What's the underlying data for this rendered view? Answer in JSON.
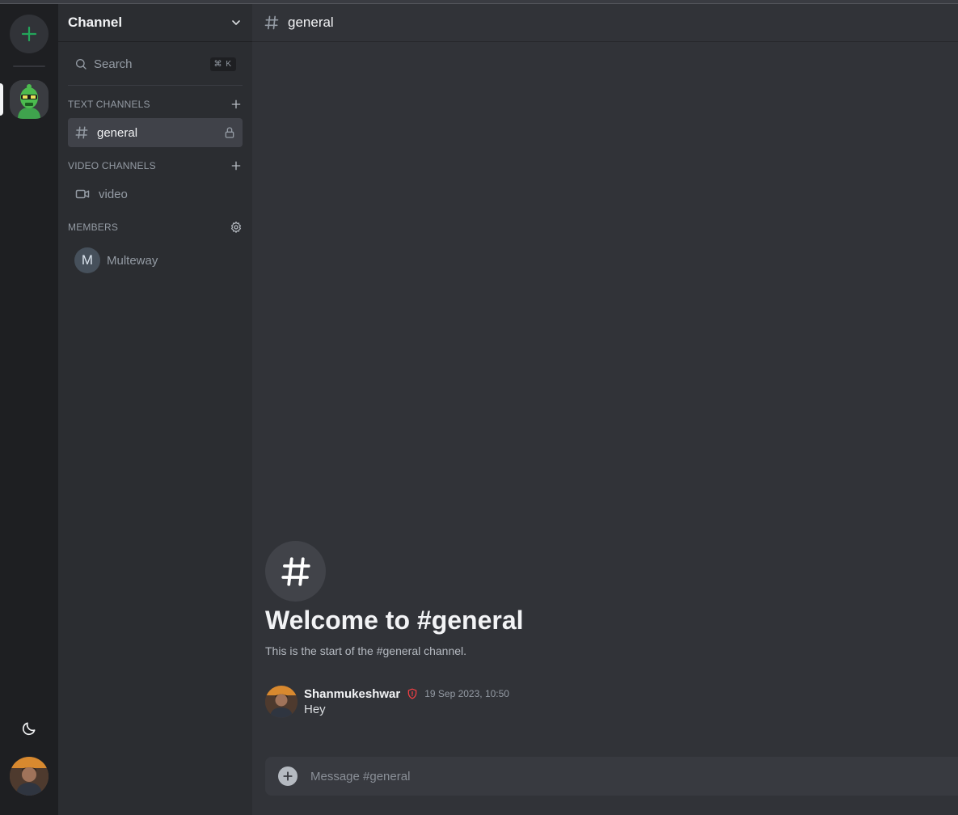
{
  "sidebar": {
    "server_name": "Channel",
    "search": {
      "label": "Search",
      "shortcut": "⌘ K"
    },
    "text_channels": {
      "heading": "TEXT CHANNELS",
      "items": [
        {
          "name": "general"
        }
      ]
    },
    "video_channels": {
      "heading": "VIDEO CHANNELS",
      "items": [
        {
          "name": "video"
        }
      ]
    },
    "members": {
      "heading": "MEMBERS",
      "items": [
        {
          "initial": "M",
          "name": "Multeway"
        }
      ]
    }
  },
  "header": {
    "channel_name": "general"
  },
  "welcome": {
    "title": "Welcome to #general",
    "subtitle": "This is the start of the #general channel."
  },
  "messages": [
    {
      "author": "Shanmukeshwar",
      "timestamp": "19 Sep 2023, 10:50",
      "text": "Hey"
    }
  ],
  "composer": {
    "placeholder": "Message #general"
  },
  "colors": {
    "accent_green": "#23a55a",
    "admin_badge": "#f23f43"
  },
  "icons": [
    "plus-icon",
    "moon-icon",
    "chevron-down-icon",
    "search-icon",
    "hash-icon",
    "lock-icon",
    "video-icon",
    "gear-icon",
    "shield-icon"
  ]
}
